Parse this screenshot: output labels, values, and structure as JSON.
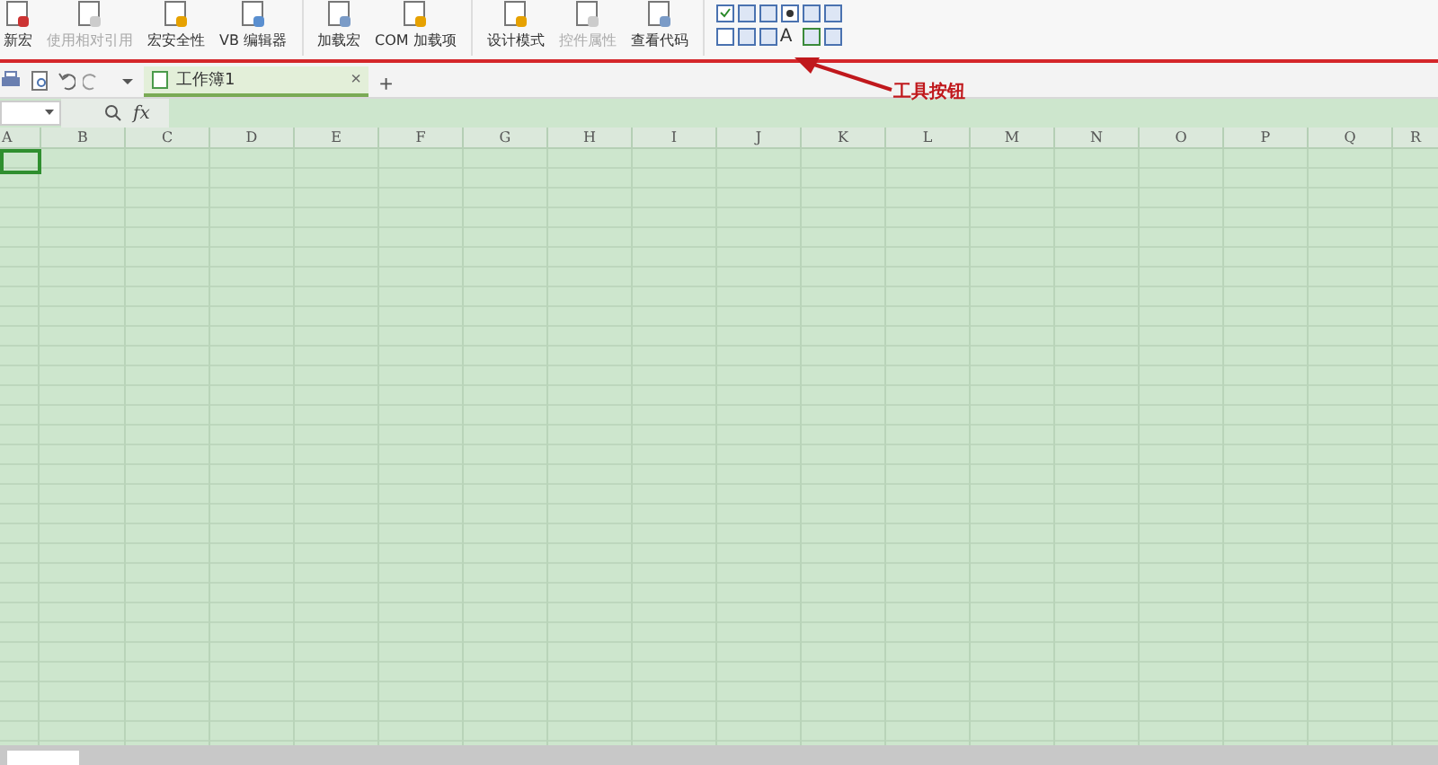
{
  "ribbon": {
    "groups": [
      {
        "buttons": [
          {
            "label": "新宏",
            "disabled": false
          },
          {
            "label": "使用相对引用",
            "disabled": true
          },
          {
            "label": "宏安全性",
            "disabled": false
          },
          {
            "label": "VB 编辑器",
            "disabled": false
          }
        ]
      },
      {
        "buttons": [
          {
            "label": "加载宏",
            "disabled": false
          },
          {
            "label": "COM 加载项",
            "disabled": false
          }
        ]
      },
      {
        "buttons": [
          {
            "label": "设计模式",
            "disabled": false
          },
          {
            "label": "控件属性",
            "disabled": true
          },
          {
            "label": "查看代码",
            "disabled": false
          }
        ]
      }
    ],
    "controls_label": "A"
  },
  "tabs": [
    {
      "label": "工作簿1",
      "selected": true,
      "close": "×"
    }
  ],
  "new_tab": "+",
  "formula_bar": {
    "fx": "fx"
  },
  "columns": [
    "A",
    "B",
    "C",
    "D",
    "E",
    "F",
    "G",
    "H",
    "I",
    "J",
    "K",
    "L",
    "M",
    "N",
    "O",
    "P",
    "Q",
    "R"
  ],
  "annotation": {
    "label": "工具按钮"
  }
}
